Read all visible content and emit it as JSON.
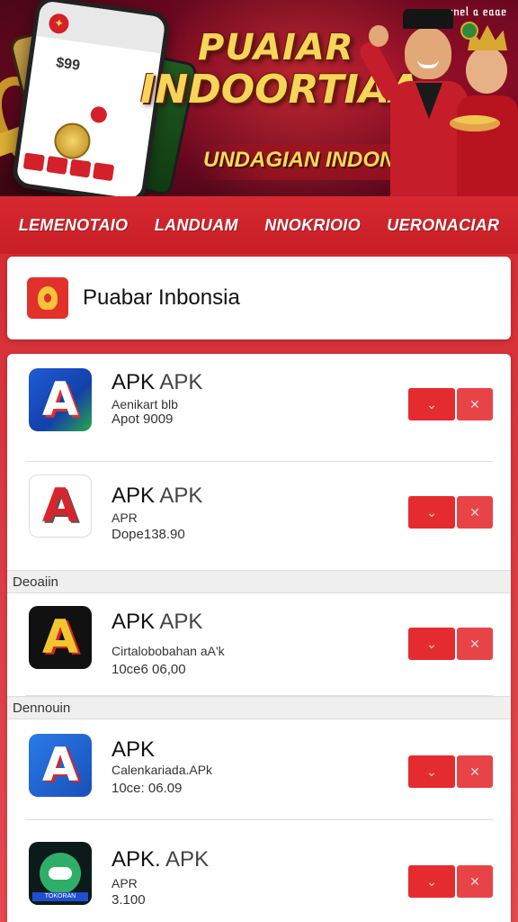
{
  "banner": {
    "tag": "ᥙᥒᥱᥣ ᥲ ᥱᥲᥲᥱ",
    "title_line1": "PUAIAR",
    "title_line2": "INDOORTIAA",
    "subtitle": "UNDAGIAN INDONESIA",
    "phone_number": "$99"
  },
  "categories": [
    {
      "label": "LEMENOTAIO"
    },
    {
      "label": "LANDUAM"
    },
    {
      "label": "NNOKRIOIO"
    },
    {
      "label": "UERONACIAR"
    }
  ],
  "header": {
    "title": "Puabar Inbonsia"
  },
  "apps": [
    {
      "name_a": "APK",
      "name_b": "APK",
      "sub": "Aenikart blb",
      "size": "Apot 9009",
      "icon": "a-blue-icon",
      "glyph": "A"
    },
    {
      "name_a": "APK",
      "name_b": "APK",
      "sub": "APR",
      "size": "Dope138.90",
      "icon": "a-red-white-icon",
      "glyph": "A"
    },
    {
      "name_a": "APK",
      "name_b": "APK",
      "sub": "Cirtalobobahan aA'k",
      "size": "10ce6 06,00",
      "icon": "a-yellow-black-icon",
      "glyph": "A"
    },
    {
      "name_a": "APK",
      "name_b": "",
      "sub": "Calenkariada.APk",
      "size": "10ce: 06.09",
      "icon": "a-blue-white-icon",
      "glyph": "A"
    },
    {
      "name_a": "APK.",
      "name_b": "APK",
      "sub": "APR",
      "size": "3.100",
      "icon": "green-circle-icon",
      "glyph": ""
    }
  ],
  "sections": {
    "s1": "Deoaiin",
    "s2": "Dennouin"
  },
  "buttons": {
    "primary_glyph": "⌄",
    "secondary_glyph": "✕"
  },
  "icon_strip_text": "TOKORAN",
  "colors": {
    "accent": "#e42c30",
    "nav": "#c81e25",
    "gold": "#f5d55a"
  }
}
